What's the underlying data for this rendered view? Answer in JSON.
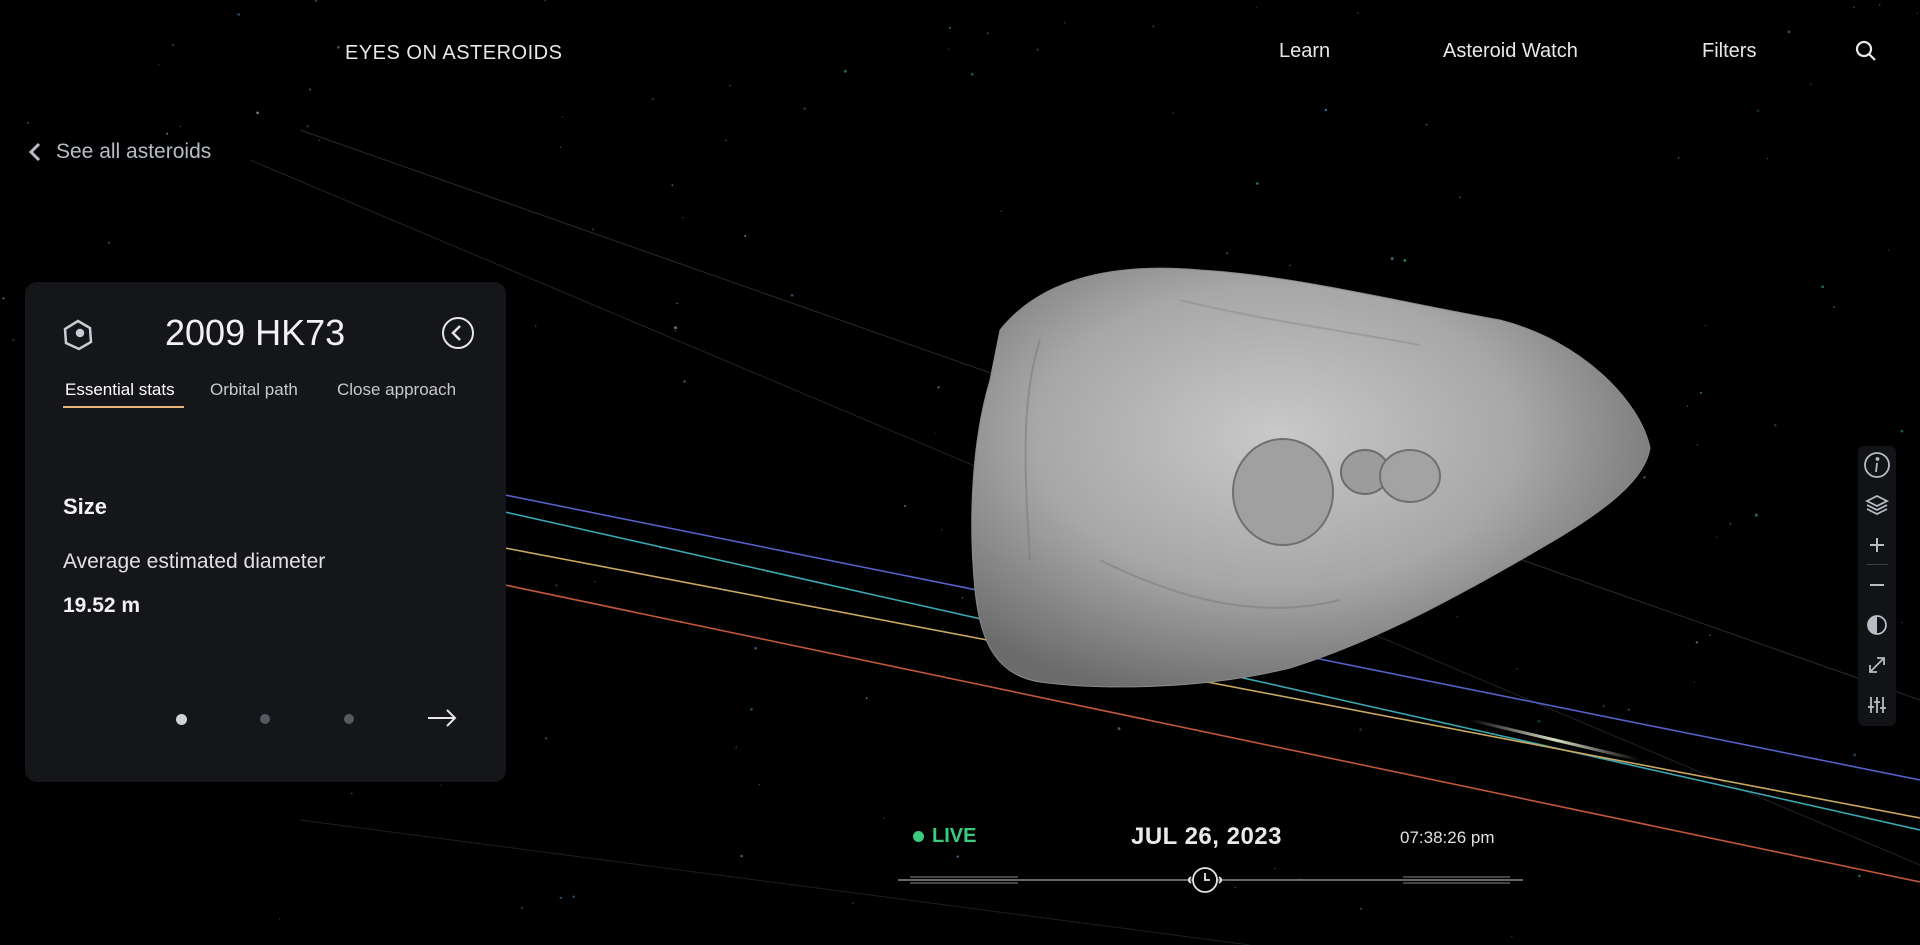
{
  "header": {
    "brand": "EYES ON ASTEROIDS",
    "nav": [
      {
        "label": "Learn"
      },
      {
        "label": "Asteroid Watch"
      },
      {
        "label": "Filters"
      }
    ],
    "search_icon": "search-icon"
  },
  "back_link": {
    "label": "See all asteroids",
    "icon": "chevron-left-icon"
  },
  "panel": {
    "title": "2009 HK73",
    "icon": "asteroid-icon",
    "collapse_icon": "circle-chevron-left-icon",
    "tabs": [
      {
        "label": "Essential stats",
        "active": true
      },
      {
        "label": "Orbital path",
        "active": false
      },
      {
        "label": "Close approach",
        "active": false
      }
    ],
    "section_heading": "Size",
    "stat_label": "Average estimated diameter",
    "stat_value": "19.52 m",
    "pagination": {
      "total": 3,
      "current": 1
    },
    "next_icon": "arrow-right-icon"
  },
  "toolbar": [
    "info-icon",
    "layers-icon",
    "zoom-in-icon",
    "zoom-out-icon",
    "contrast-icon",
    "fullscreen-icon",
    "settings-sliders-icon"
  ],
  "timebar": {
    "live_label": "LIVE",
    "date": "JUL 26, 2023",
    "time": "07:38:26 pm"
  },
  "colors": {
    "live_green": "#3ccb7f",
    "tab_accent": "#e6b37a",
    "panel_bg": "#151619",
    "orbit_blue": "#5560c8",
    "orbit_teal": "#3aa6b0",
    "orbit_gold": "#c8a860",
    "orbit_red": "#c0563a"
  }
}
